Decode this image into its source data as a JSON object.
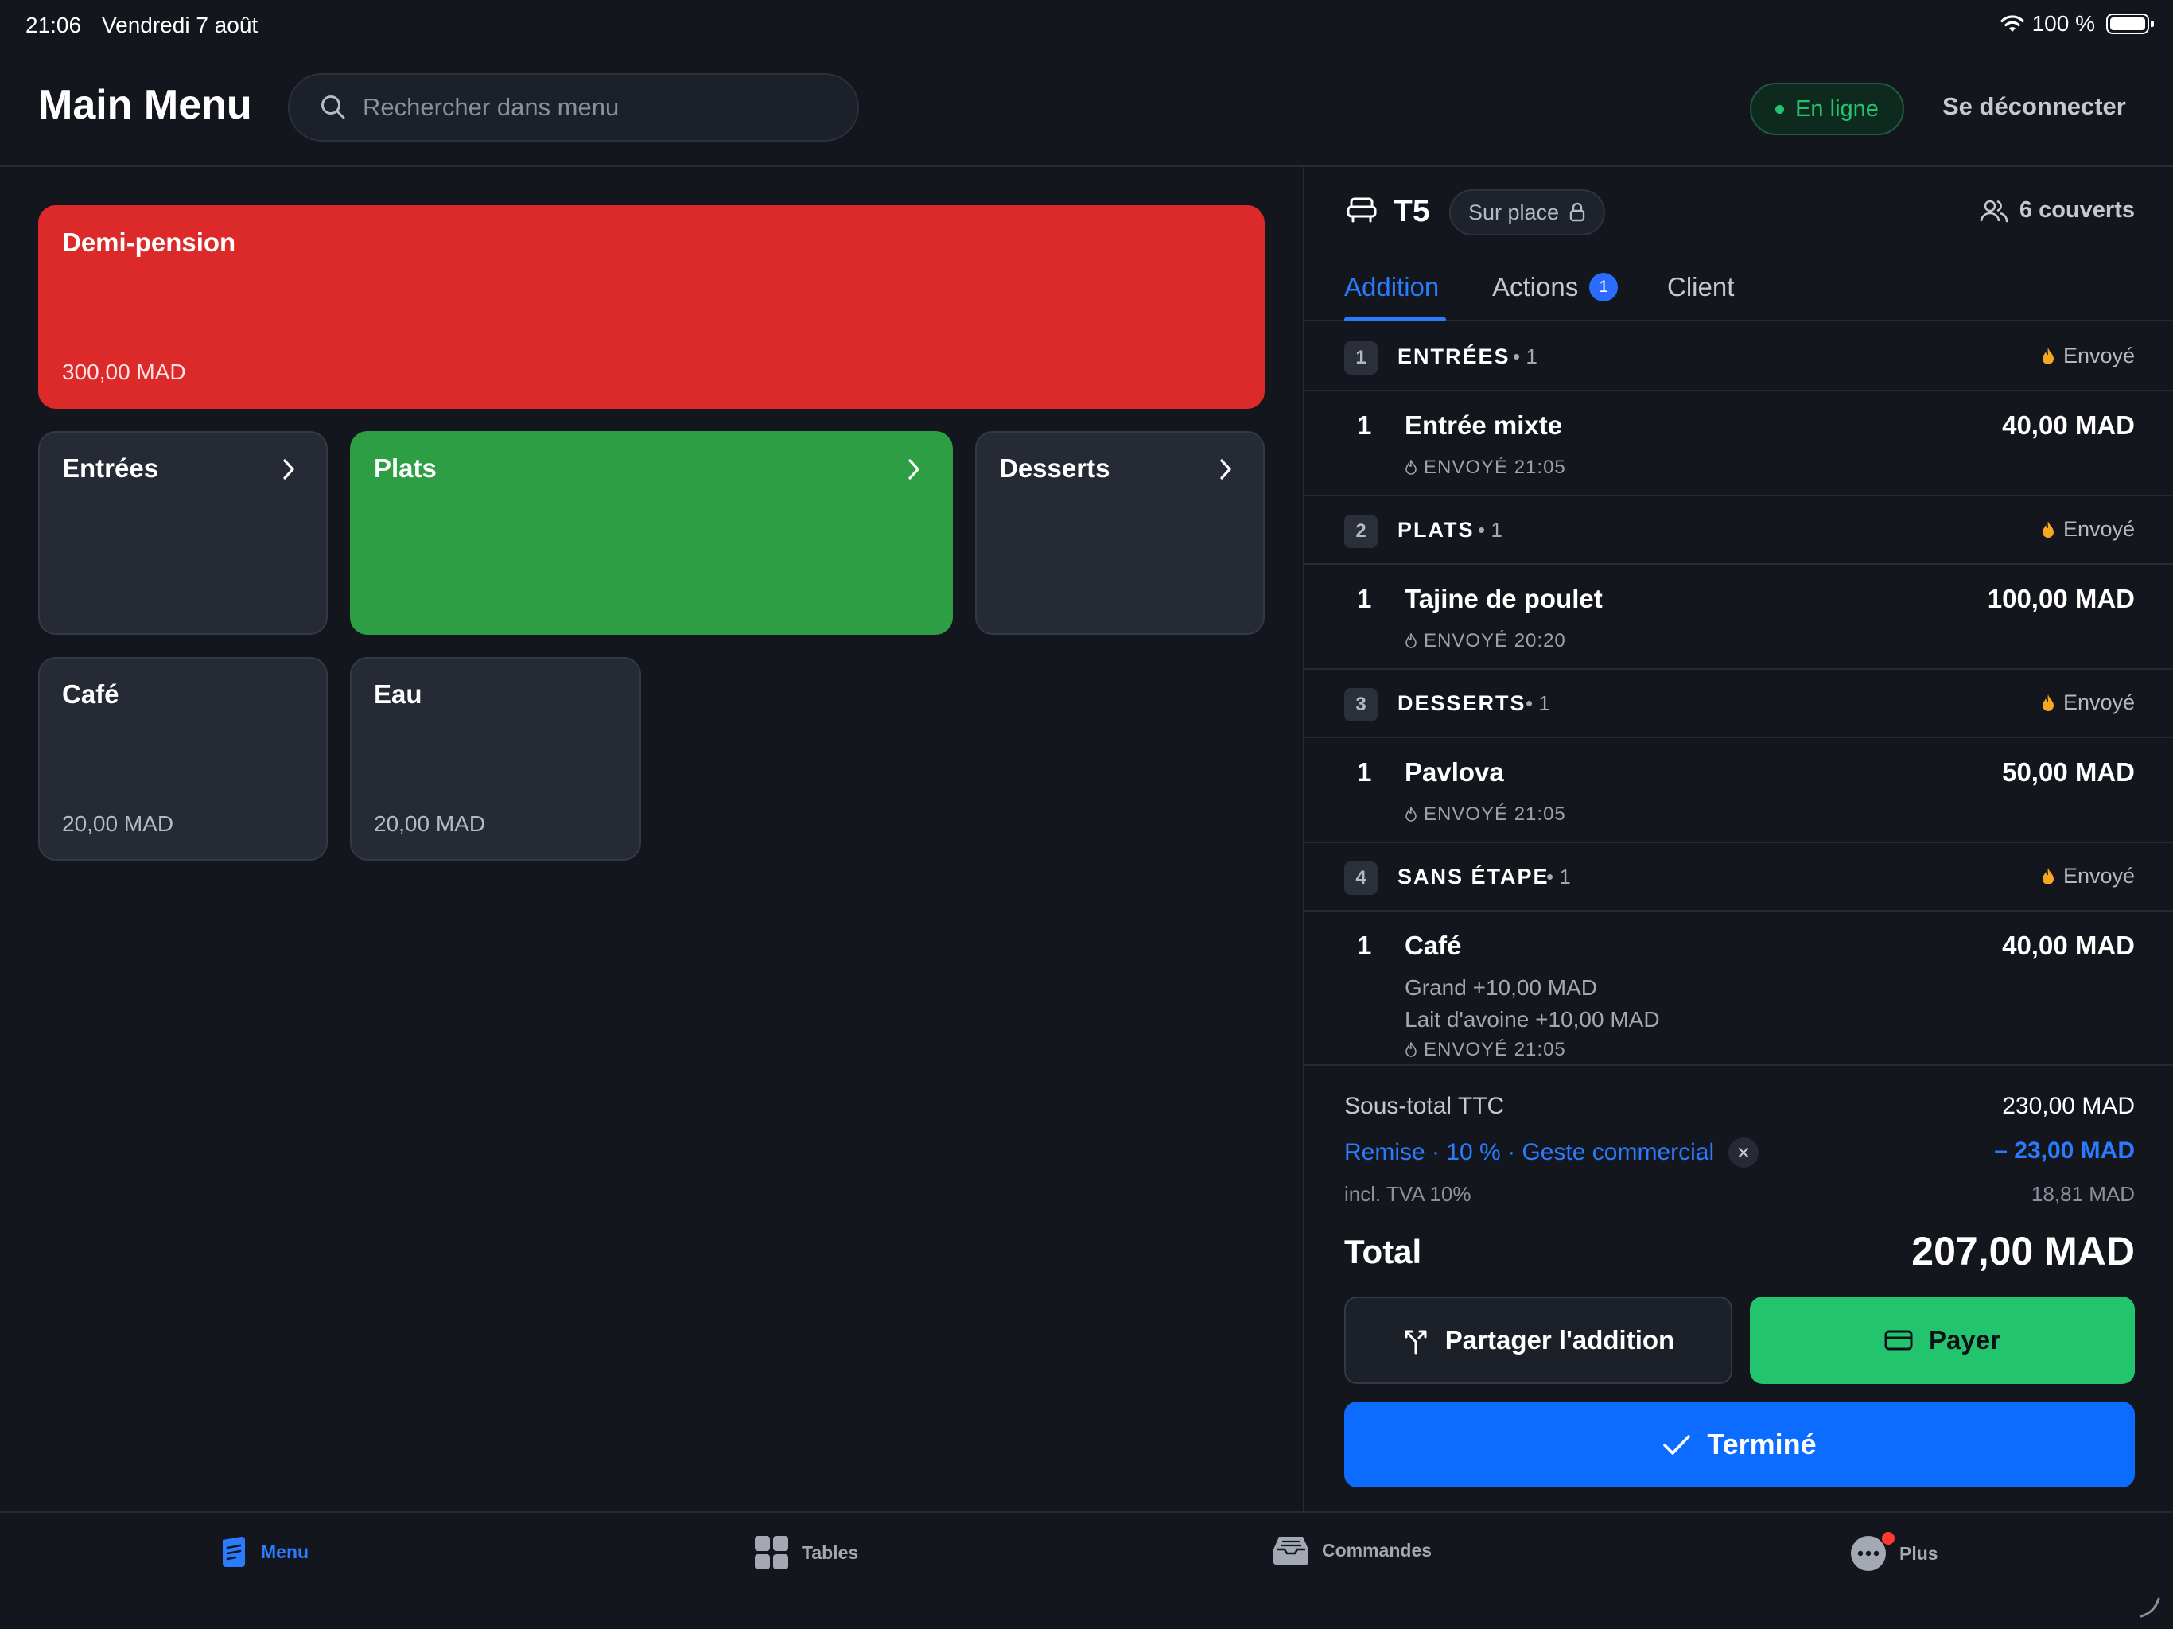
{
  "status_bar": {
    "time": "21:06",
    "date": "Vendredi 7 août",
    "battery": "100 %"
  },
  "header": {
    "title": "Main Menu",
    "search_placeholder": "Rechercher dans menu",
    "status_label": "En ligne",
    "logout_label": "Se déconnecter"
  },
  "menu": {
    "featured": {
      "name": "Demi-pension",
      "price": "300,00 MAD",
      "color": "#dc2a2a"
    },
    "categories": [
      {
        "name": "Entrées"
      },
      {
        "name": "Plats",
        "color": "#2e9e45"
      },
      {
        "name": "Desserts"
      }
    ],
    "items": [
      {
        "name": "Café",
        "price": "20,00 MAD"
      },
      {
        "name": "Eau",
        "price": "20,00 MAD"
      }
    ]
  },
  "ticket": {
    "table": "T5",
    "service_mode": "Sur place",
    "covers": "6 couverts",
    "tabs": [
      {
        "label": "Addition"
      },
      {
        "label": "Actions",
        "badge": "1"
      },
      {
        "label": "Client"
      }
    ],
    "sections": [
      {
        "step": "1",
        "name": "ENTRÉES",
        "count": "• 1",
        "status": "Envoyé",
        "item": {
          "qty": "1",
          "name": "Entrée mixte",
          "price": "40,00 MAD",
          "sent": "ENVOYÉ 21:05"
        }
      },
      {
        "step": "2",
        "name": "PLATS",
        "count": "• 1",
        "status": "Envoyé",
        "item": {
          "qty": "1",
          "name": "Tajine de poulet",
          "price": "100,00 MAD",
          "sent": "ENVOYÉ 20:20"
        }
      },
      {
        "step": "3",
        "name": "DESSERTS",
        "count": "• 1",
        "status": "Envoyé",
        "item": {
          "qty": "1",
          "name": "Pavlova",
          "price": "50,00 MAD",
          "sent": "ENVOYÉ 21:05"
        }
      },
      {
        "step": "4",
        "name": "SANS ÉTAPE",
        "count": "• 1",
        "status": "Envoyé",
        "item": {
          "qty": "1",
          "name": "Café",
          "price": "40,00 MAD",
          "sent": "ENVOYÉ 21:05",
          "modifiers": [
            "Grand +10,00 MAD",
            "Lait d'avoine +10,00 MAD"
          ]
        }
      }
    ],
    "totals": {
      "subtotal_label": "Sous-total TTC",
      "subtotal": "230,00 MAD",
      "discount_label": "Remise · 10 % · Geste commercial",
      "discount": "– 23,00 MAD",
      "tva_label": "incl. TVA 10%",
      "tva": "18,81 MAD",
      "total_label": "Total",
      "total": "207,00 MAD"
    },
    "actions": {
      "split": "Partager l'addition",
      "pay": "Payer",
      "done": "Terminé"
    }
  },
  "nav": [
    {
      "label": "Menu",
      "icon": "menu-book-icon"
    },
    {
      "label": "Tables",
      "icon": "grid-icon"
    },
    {
      "label": "Commandes",
      "icon": "inbox-tray-icon"
    },
    {
      "label": "Plus",
      "icon": "more-icon"
    }
  ],
  "colors": {
    "accent": "#2b7bff",
    "success": "#22c56e",
    "danger": "#dc2a2a",
    "background": "#13161d"
  }
}
